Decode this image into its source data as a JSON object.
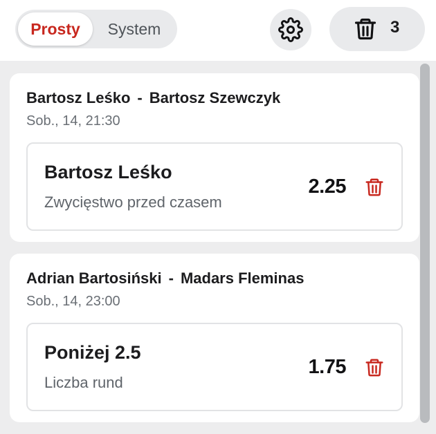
{
  "header": {
    "mode_tabs": [
      {
        "label": "Prosty",
        "active": true
      },
      {
        "label": "System",
        "active": false
      }
    ],
    "settings_icon": "gear-icon",
    "clear_all": {
      "icon": "trash-icon",
      "count": "3"
    }
  },
  "colors": {
    "accent": "#c8281f",
    "pill_bg": "#e9eaec",
    "list_bg": "#ededee"
  },
  "bets": [
    {
      "match": {
        "home": "Bartosz Leśko",
        "separator": "-",
        "away": "Bartosz Szewczyk"
      },
      "datetime": "Sob., 14, 21:30",
      "selection": "Bartosz Leśko",
      "market": "Zwycięstwo przed czasem",
      "odds": "2.25",
      "remove_icon": "trash-icon"
    },
    {
      "match": {
        "home": "Adrian Bartosiński",
        "separator": "-",
        "away": "Madars Fleminas"
      },
      "datetime": "Sob., 14, 23:00",
      "selection": "Poniżej 2.5",
      "market": "Liczba rund",
      "odds": "1.75",
      "remove_icon": "trash-icon"
    }
  ]
}
